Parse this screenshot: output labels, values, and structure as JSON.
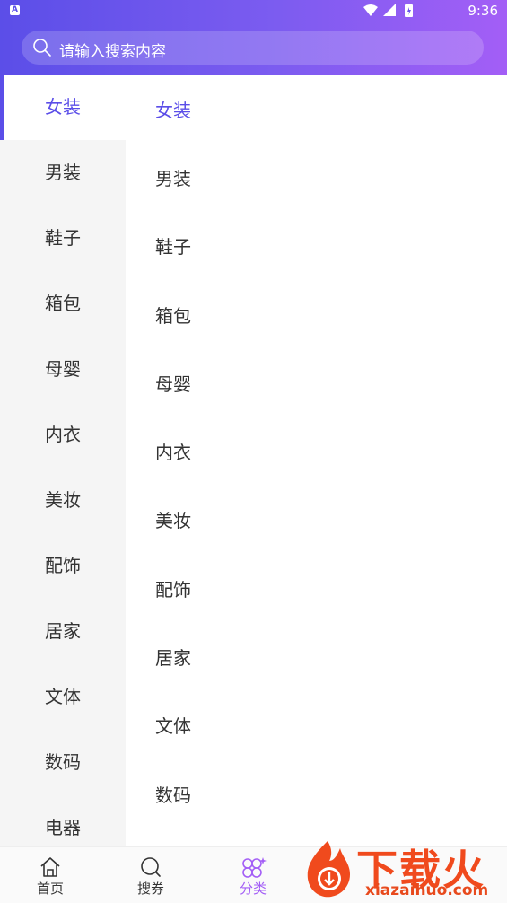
{
  "status_bar": {
    "app_badge": "A",
    "time": "9:36",
    "icons": [
      "wifi-icon",
      "signal-icon",
      "battery-icon"
    ]
  },
  "search": {
    "placeholder": "请输入搜索内容"
  },
  "sidebar": {
    "items": [
      {
        "label": "女装",
        "active": true
      },
      {
        "label": "男装"
      },
      {
        "label": "鞋子"
      },
      {
        "label": "箱包"
      },
      {
        "label": "母婴"
      },
      {
        "label": "内衣"
      },
      {
        "label": "美妆"
      },
      {
        "label": "配饰"
      },
      {
        "label": "居家"
      },
      {
        "label": "文体"
      },
      {
        "label": "数码"
      },
      {
        "label": "电器"
      }
    ]
  },
  "content": {
    "items": [
      {
        "label": "女装",
        "active": true
      },
      {
        "label": "男装"
      },
      {
        "label": "鞋子"
      },
      {
        "label": "箱包"
      },
      {
        "label": "母婴"
      },
      {
        "label": "内衣"
      },
      {
        "label": "美妆"
      },
      {
        "label": "配饰"
      },
      {
        "label": "居家"
      },
      {
        "label": "文体"
      },
      {
        "label": "数码"
      }
    ]
  },
  "tabbar": {
    "tabs": [
      {
        "label": "首页",
        "icon": "home-icon"
      },
      {
        "label": "搜券",
        "icon": "search-icon"
      },
      {
        "label": "分类",
        "icon": "category-icon",
        "active": true
      }
    ]
  },
  "watermark": {
    "text": "下载火",
    "url": "xiazaihuo.com"
  },
  "colors": {
    "accent": "#5b4ee8",
    "accent_end": "#a35ef6",
    "sidebar_bg": "#f5f5f5"
  }
}
